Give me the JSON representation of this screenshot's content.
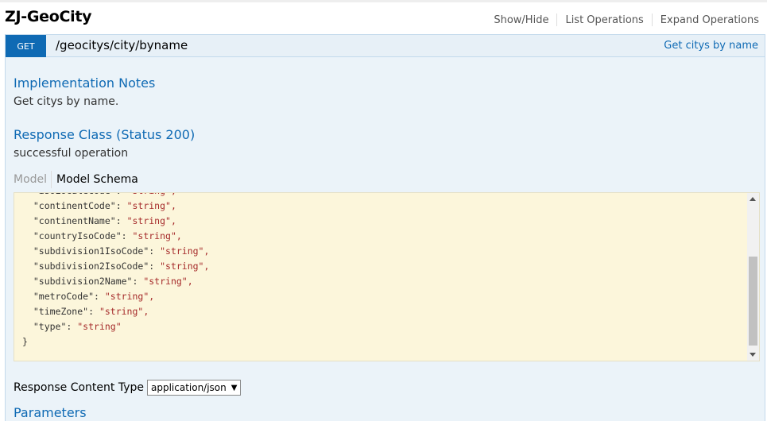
{
  "header": {
    "title": "ZJ-GeoCity",
    "links": [
      "Show/Hide",
      "List Operations",
      "Expand Operations"
    ]
  },
  "operation": {
    "method": "GET",
    "path": "/geocitys/city/byname",
    "summary": "Get citys by name",
    "colors": {
      "method_bg": "#0f6ab4",
      "heading_bg": "#e7f0f7",
      "content_bg": "#ebf3f9"
    }
  },
  "content": {
    "impl_heading": "Implementation Notes",
    "impl_text": "Get citys by name.",
    "response_heading": "Response Class (Status 200)",
    "response_text": "successful operation",
    "tab_model": "Model",
    "tab_schema": "Model Schema",
    "schema_lines": [
      {
        "key": "\"isoLocaleCode\"",
        "val": "\"string\","
      },
      {
        "key": "\"continentCode\"",
        "val": "\"string\","
      },
      {
        "key": "\"continentName\"",
        "val": "\"string\","
      },
      {
        "key": "\"countryIsoCode\"",
        "val": "\"string\","
      },
      {
        "key": "\"subdivision1IsoCode\"",
        "val": "\"string\","
      },
      {
        "key": "\"subdivision2IsoCode\"",
        "val": "\"string\","
      },
      {
        "key": "\"subdivision2Name\"",
        "val": "\"string\","
      },
      {
        "key": "\"metroCode\"",
        "val": "\"string\","
      },
      {
        "key": "\"timeZone\"",
        "val": "\"string\","
      },
      {
        "key": "\"type\"",
        "val": "\"string\""
      }
    ],
    "schema_close": "}",
    "rct_label": "Response Content Type",
    "rct_value": "application/json",
    "parameters_heading": "Parameters"
  }
}
